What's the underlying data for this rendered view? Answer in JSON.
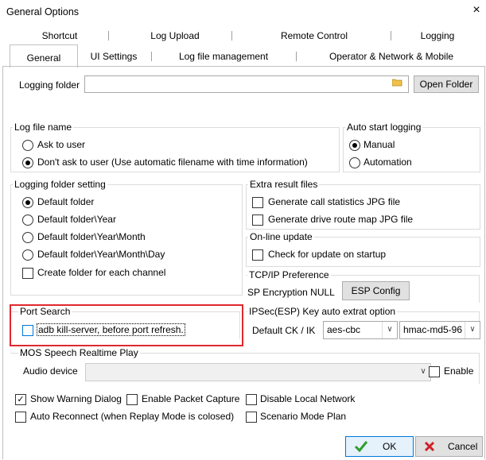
{
  "window": {
    "title": "General Options",
    "close_glyph": "×"
  },
  "tabs_row1": [
    "Shortcut",
    "Log Upload",
    "Remote Control",
    "Logging"
  ],
  "tabs_row2": [
    "General",
    "UI Settings",
    "Log file management",
    "Operator & Network & Mobile"
  ],
  "logging_folder": {
    "label": "Logging folder",
    "value": "",
    "open_button": "Open Folder"
  },
  "log_file_name": {
    "title": "Log file name",
    "options": [
      "Ask to user",
      "Don't ask to user (Use automatic filename with time information)"
    ],
    "selected": 1
  },
  "auto_start": {
    "title": "Auto start logging",
    "options": [
      "Manual",
      "Automation"
    ],
    "selected": 0
  },
  "folder_setting": {
    "title": "Logging folder setting",
    "options": [
      "Default folder",
      "Default folder\\Year",
      "Default folder\\Year\\Month",
      "Default folder\\Year\\Month\\Day"
    ],
    "selected": 0,
    "create_folder": "Create folder for each channel"
  },
  "extra_result": {
    "title": "Extra result files",
    "items": [
      "Generate call statistics JPG file",
      "Generate drive route map JPG file"
    ]
  },
  "online_update": {
    "title": "On-line update",
    "item": "Check for update on startup"
  },
  "tcpip": {
    "title": "TCP/IP Preference",
    "label": "SP Encryption NULL",
    "button": "ESP Config"
  },
  "port_search": {
    "title": "Port Search",
    "item": "adb kill-server, before port refresh."
  },
  "ipsec": {
    "title": "IPSec(ESP) Key auto extrat option",
    "label": "Default CK / IK",
    "ck": "aes-cbc",
    "ik": "hmac-md5-96"
  },
  "mos": {
    "title": "MOS Speech Realtime Play",
    "audio_label": "Audio device",
    "audio_value": "",
    "enable": "Enable"
  },
  "bottom_checks": [
    {
      "label": "Show Warning Dialog",
      "checked": true
    },
    {
      "label": "Enable Packet Capture",
      "checked": false
    },
    {
      "label": "Disable Local Network",
      "checked": false
    },
    {
      "label": "Auto Reconnect (when Replay Mode is colosed)",
      "checked": false
    },
    {
      "label": "Scenario Mode Plan",
      "checked": false
    }
  ],
  "buttons": {
    "ok": "OK",
    "cancel": "Cancel"
  },
  "colors": {
    "accent": "#0078d7",
    "highlight": "#e0282e",
    "ok_icon": "#2e9e2e",
    "cancel_icon": "#d0202a"
  }
}
